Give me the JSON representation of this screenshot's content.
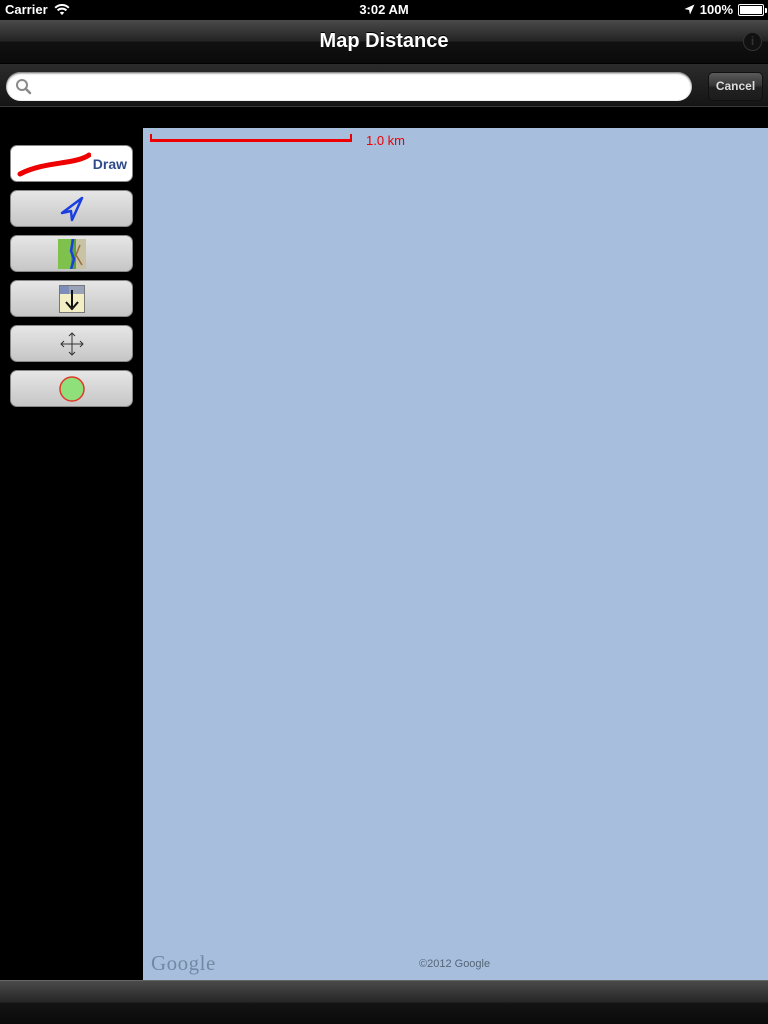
{
  "status_bar": {
    "carrier": "Carrier",
    "time": "3:02 AM",
    "battery": "100%",
    "battery_level": 1.0
  },
  "nav": {
    "title": "Map Distance",
    "info_icon": "info-icon"
  },
  "search": {
    "placeholder": "",
    "value": "",
    "cancel_label": "Cancel"
  },
  "tools": [
    {
      "name": "draw",
      "label": "Draw",
      "icon": "red-line-icon",
      "active": true
    },
    {
      "name": "navigate",
      "icon": "blue-arrow-icon"
    },
    {
      "name": "map-type",
      "icon": "map-thumbnail-icon"
    },
    {
      "name": "drop",
      "icon": "drop-arrow-icon"
    },
    {
      "name": "pan",
      "icon": "move-arrows-icon"
    },
    {
      "name": "marker",
      "icon": "green-circle-icon"
    }
  ],
  "map": {
    "scale_label": "1.0 km",
    "logo_text": "Google",
    "copyright": "©2012 Google",
    "water_color": "#a7bfdd",
    "scale_color": "#e00000"
  }
}
